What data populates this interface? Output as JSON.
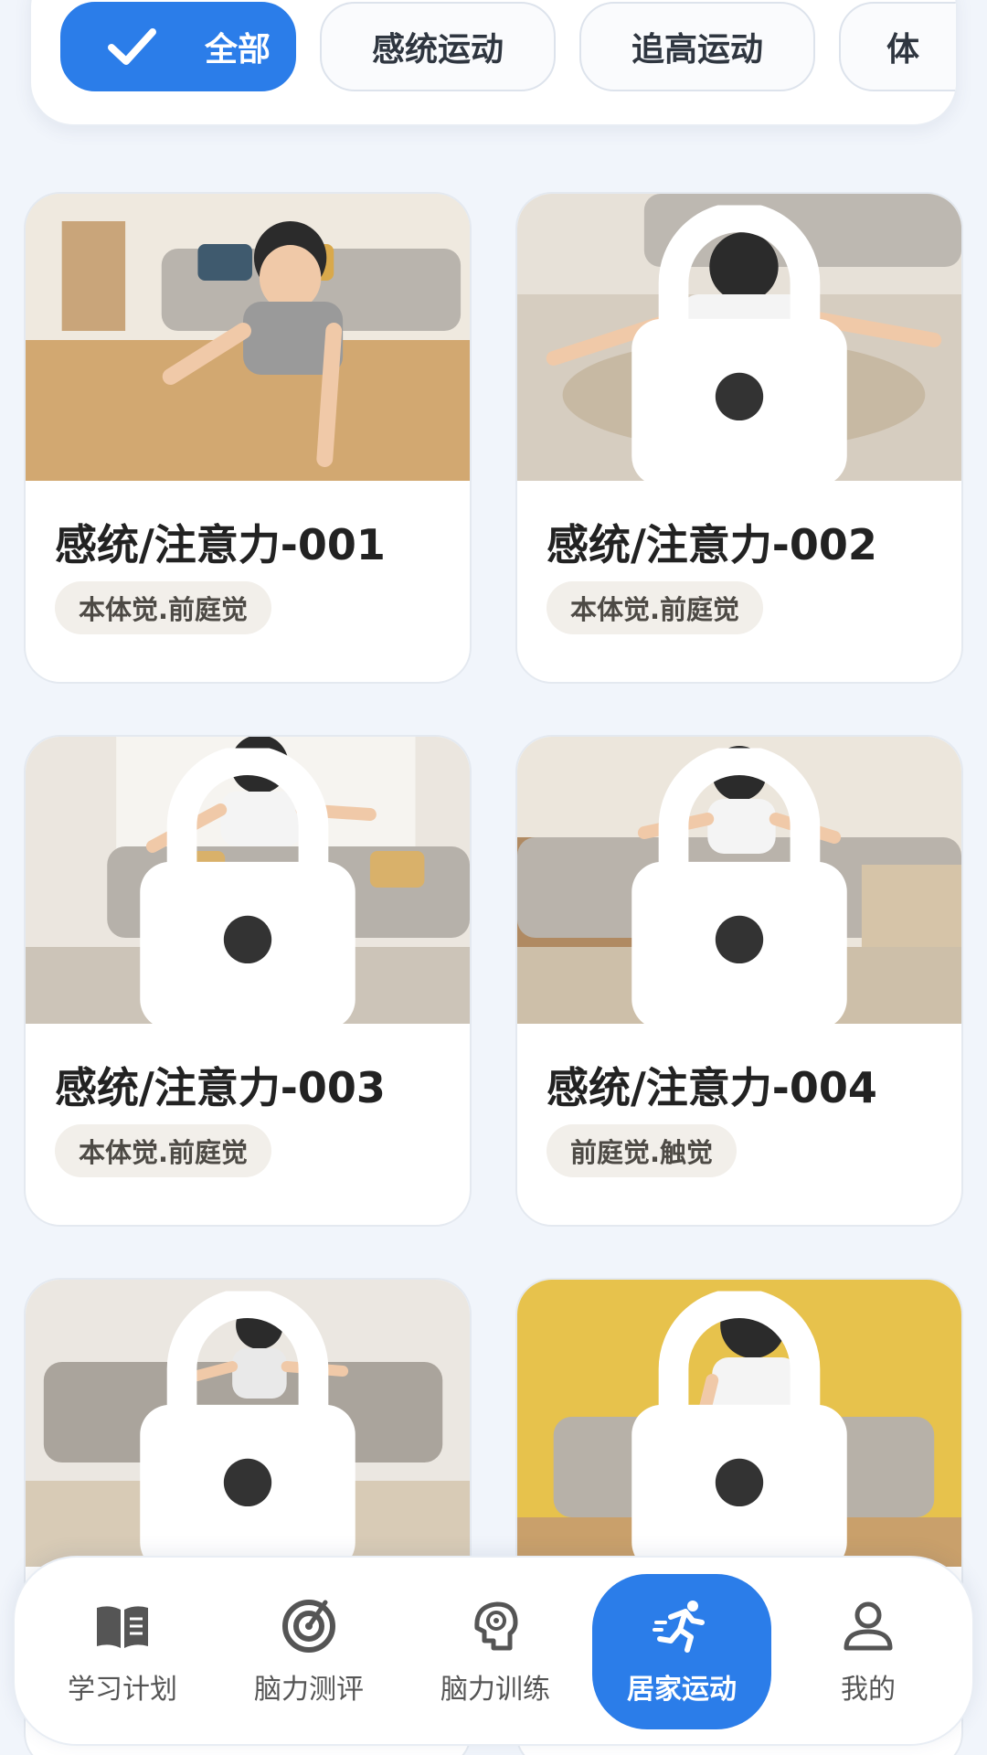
{
  "filters": [
    {
      "label": "全部",
      "active": true
    },
    {
      "label": "感统运动",
      "active": false
    },
    {
      "label": "追高运动",
      "active": false
    },
    {
      "label": "体",
      "active": false
    }
  ],
  "cards": [
    {
      "title": "感统/注意力-001",
      "tag": "本体觉.前庭觉",
      "locked": false
    },
    {
      "title": "感统/注意力-002",
      "tag": "本体觉.前庭觉",
      "locked": true
    },
    {
      "title": "感统/注意力-003",
      "tag": "本体觉.前庭觉",
      "locked": true
    },
    {
      "title": "感统/注意力-004",
      "tag": "前庭觉.触觉",
      "locked": true
    },
    {
      "title": "",
      "tag": "",
      "locked": true
    },
    {
      "title": "",
      "tag": "",
      "locked": true
    }
  ],
  "nav": [
    {
      "label": "学习计划",
      "icon": "book-icon"
    },
    {
      "label": "脑力测评",
      "icon": "target-icon"
    },
    {
      "label": "脑力训练",
      "icon": "brain-gear-icon"
    },
    {
      "label": "居家运动",
      "icon": "running-icon",
      "active": true
    },
    {
      "label": "我的",
      "icon": "user-icon"
    }
  ],
  "colors": {
    "accent": "#2b7de9",
    "tag_bg": "#f2efea",
    "page_bg": "#f1f5fb"
  }
}
